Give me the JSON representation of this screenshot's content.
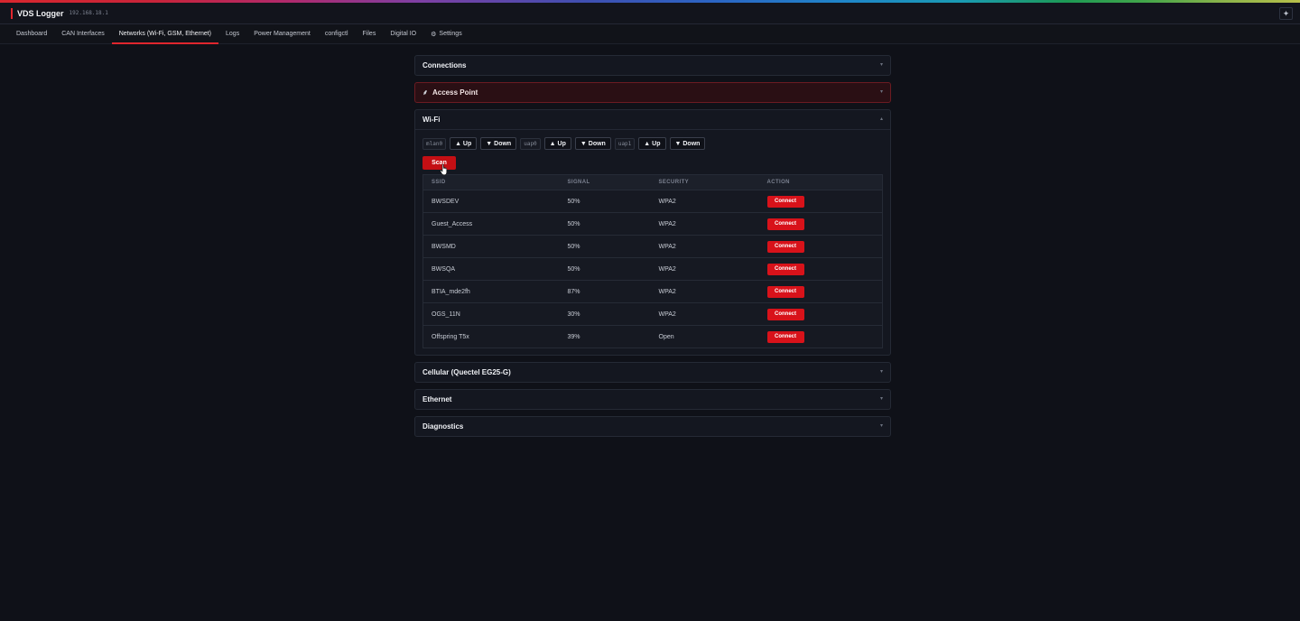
{
  "app": {
    "title": "VDS Logger",
    "ip": "192.168.18.1",
    "corner_icon": "sparkle-icon"
  },
  "nav": {
    "items": [
      {
        "label": "Dashboard",
        "active": false
      },
      {
        "label": "CAN Interfaces",
        "active": false
      },
      {
        "label": "Networks (Wi-Fi, GSM, Ethernet)",
        "active": true
      },
      {
        "label": "Logs",
        "active": false
      },
      {
        "label": "Power Management",
        "active": false
      },
      {
        "label": "configctl",
        "active": false
      },
      {
        "label": "Files",
        "active": false
      },
      {
        "label": "Digital IO",
        "active": false
      },
      {
        "label": "Settings",
        "active": false,
        "icon": "gear-icon"
      }
    ]
  },
  "panels": {
    "connections": {
      "title": "Connections"
    },
    "access_point": {
      "title": "Access Point",
      "icon": "broadcast-icon"
    },
    "wifi": {
      "title": "Wi-Fi",
      "interfaces": [
        {
          "name": "mlan0",
          "up_label": "▲ Up",
          "down_label": "▼ Down"
        },
        {
          "name": "uap0",
          "up_label": "▲ Up",
          "down_label": "▼ Down"
        },
        {
          "name": "uap1",
          "up_label": "▲ Up",
          "down_label": "▼ Down"
        }
      ],
      "scan_label": "Scan",
      "table": {
        "headers": [
          "SSID",
          "SIGNAL",
          "SECURITY",
          "ACTION"
        ],
        "rows": [
          {
            "ssid": "BWSDEV",
            "signal": "50%",
            "security": "WPA2",
            "action": "Connect"
          },
          {
            "ssid": "Guest_Access",
            "signal": "50%",
            "security": "WPA2",
            "action": "Connect"
          },
          {
            "ssid": "BWSMD",
            "signal": "50%",
            "security": "WPA2",
            "action": "Connect"
          },
          {
            "ssid": "BWSQA",
            "signal": "50%",
            "security": "WPA2",
            "action": "Connect"
          },
          {
            "ssid": "BTIA_mde2fh",
            "signal": "87%",
            "security": "WPA2",
            "action": "Connect"
          },
          {
            "ssid": "OGS_11N",
            "signal": "30%",
            "security": "WPA2",
            "action": "Connect"
          },
          {
            "ssid": "Offspring T5x",
            "signal": "39%",
            "security": "Open",
            "action": "Connect"
          }
        ]
      }
    },
    "cellular": {
      "title": "Cellular (Quectel EG25-G)"
    },
    "ethernet": {
      "title": "Ethernet"
    },
    "diagnostics": {
      "title": "Diagnostics"
    }
  },
  "colors": {
    "accent": "#e0262e",
    "signal_good": "#2fa34a",
    "signal_mid": "#e38b1b",
    "signal_bad": "#d6202a"
  }
}
